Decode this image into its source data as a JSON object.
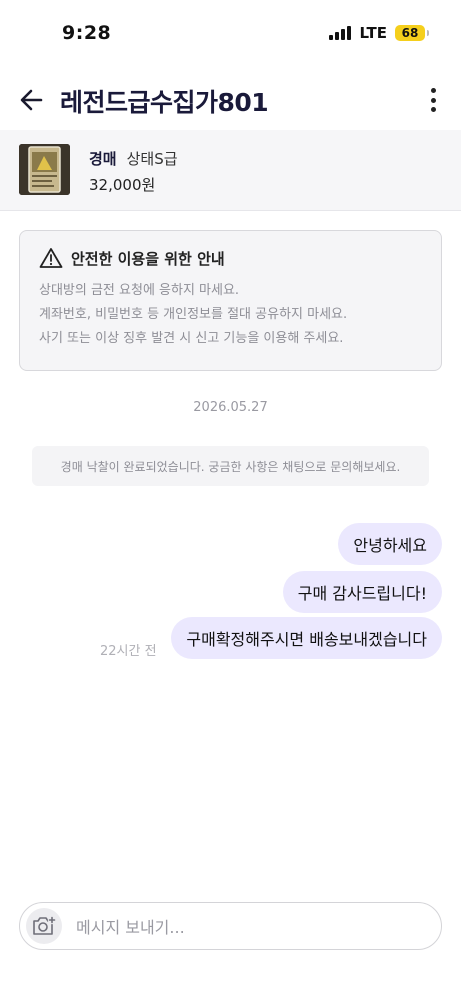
{
  "status_bar": {
    "time": "9:28",
    "network": "LTE",
    "battery": "68",
    "battery_color": "#f5cf1c"
  },
  "header": {
    "title": "레전드급수집가801",
    "back_icon": "arrow-left-icon",
    "more_icon": "more-vertical-icon"
  },
  "product": {
    "sale_type": "경매",
    "condition": "상태S급",
    "price": "32,000원"
  },
  "notice": {
    "icon": "warning-triangle-icon",
    "title": "안전한 이용을 위한 안내",
    "lines": [
      "상대방의 금전 요청에 응하지 마세요.",
      "계좌번호, 비밀번호 등 개인정보를 절대 공유하지 마세요.",
      "사기 또는 이상 징후 발견 시 신고 기능을 이용해 주세요."
    ]
  },
  "chat": {
    "date": "2026.05.27",
    "system_message": "경매 낙찰이 완료되었습니다. 궁금한 사항은 채팅으로 문의해보세요.",
    "messages": [
      "안녕하세요",
      "구매 감사드립니다!",
      "구매확정해주시면 배송보내겠습니다"
    ],
    "last_time": "22시간 전",
    "bubble_color": "#ebe8fe"
  },
  "input": {
    "placeholder": "메시지 보내기...",
    "camera_icon": "camera-plus-icon"
  }
}
